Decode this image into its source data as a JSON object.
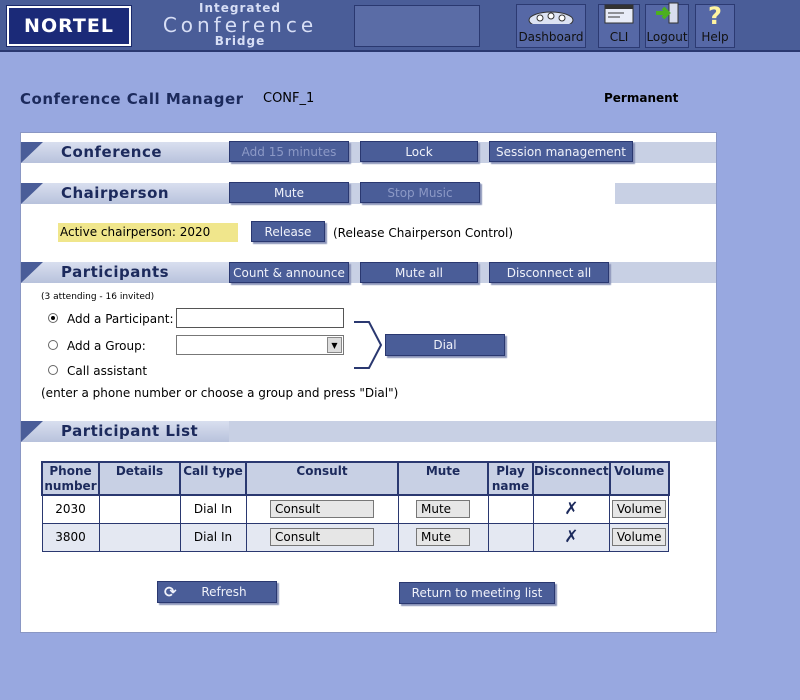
{
  "header": {
    "logo_text": "NORTEL",
    "product_line1": "Integrated",
    "product_line2": "Conference",
    "product_line3": "Bridge",
    "buttons": {
      "dashboard": "Dashboard",
      "cli": "CLI",
      "logout": "Logout",
      "help": "Help"
    }
  },
  "page": {
    "title": "Conference Call Manager",
    "conference_name": "CONF_1",
    "conference_type": "Permanent"
  },
  "conference": {
    "label": "Conference",
    "add_15": "Add 15 minutes",
    "lock": "Lock",
    "session_management": "Session management"
  },
  "chairperson": {
    "label": "Chairperson",
    "mute": "Mute",
    "stop_music": "Stop Music",
    "active": "Active chairperson: 2020",
    "release": "Release",
    "release_hint": "(Release Chairperson Control)"
  },
  "participants": {
    "label": "Participants",
    "count_announce": "Count & announce",
    "mute_all": "Mute all",
    "disconnect_all": "Disconnect all",
    "attendance": "(3 attending - 16 invited)",
    "add_participant": "Add a Participant:",
    "add_participant_value": "",
    "add_group": "Add a Group:",
    "call_assistant": "Call assistant",
    "dial": "Dial",
    "hint": "(enter a phone number or choose a group and press \"Dial\")"
  },
  "participant_list": {
    "label": "Participant List",
    "columns": [
      "Phone number",
      "Details",
      "Call type",
      "Consult",
      "Mute",
      "Play name",
      "Disconnect",
      "Volume"
    ],
    "rows": [
      {
        "phone": "2030",
        "details": "",
        "call_type": "Dial In",
        "consult": "Consult",
        "mute": "Mute",
        "play": "",
        "volume": "Volume"
      },
      {
        "phone": "3800",
        "details": "",
        "call_type": "Dial In",
        "consult": "Consult",
        "mute": "Mute",
        "play": "",
        "volume": "Volume"
      }
    ],
    "refresh": "Refresh",
    "return": "Return to meeting list"
  },
  "colors": {
    "page_bg": "#98a8e0",
    "header_bg": "#4a5d98",
    "button_bg": "#4a5d98",
    "title_text": "#1c2a5c",
    "highlight": "#f0e68c"
  }
}
